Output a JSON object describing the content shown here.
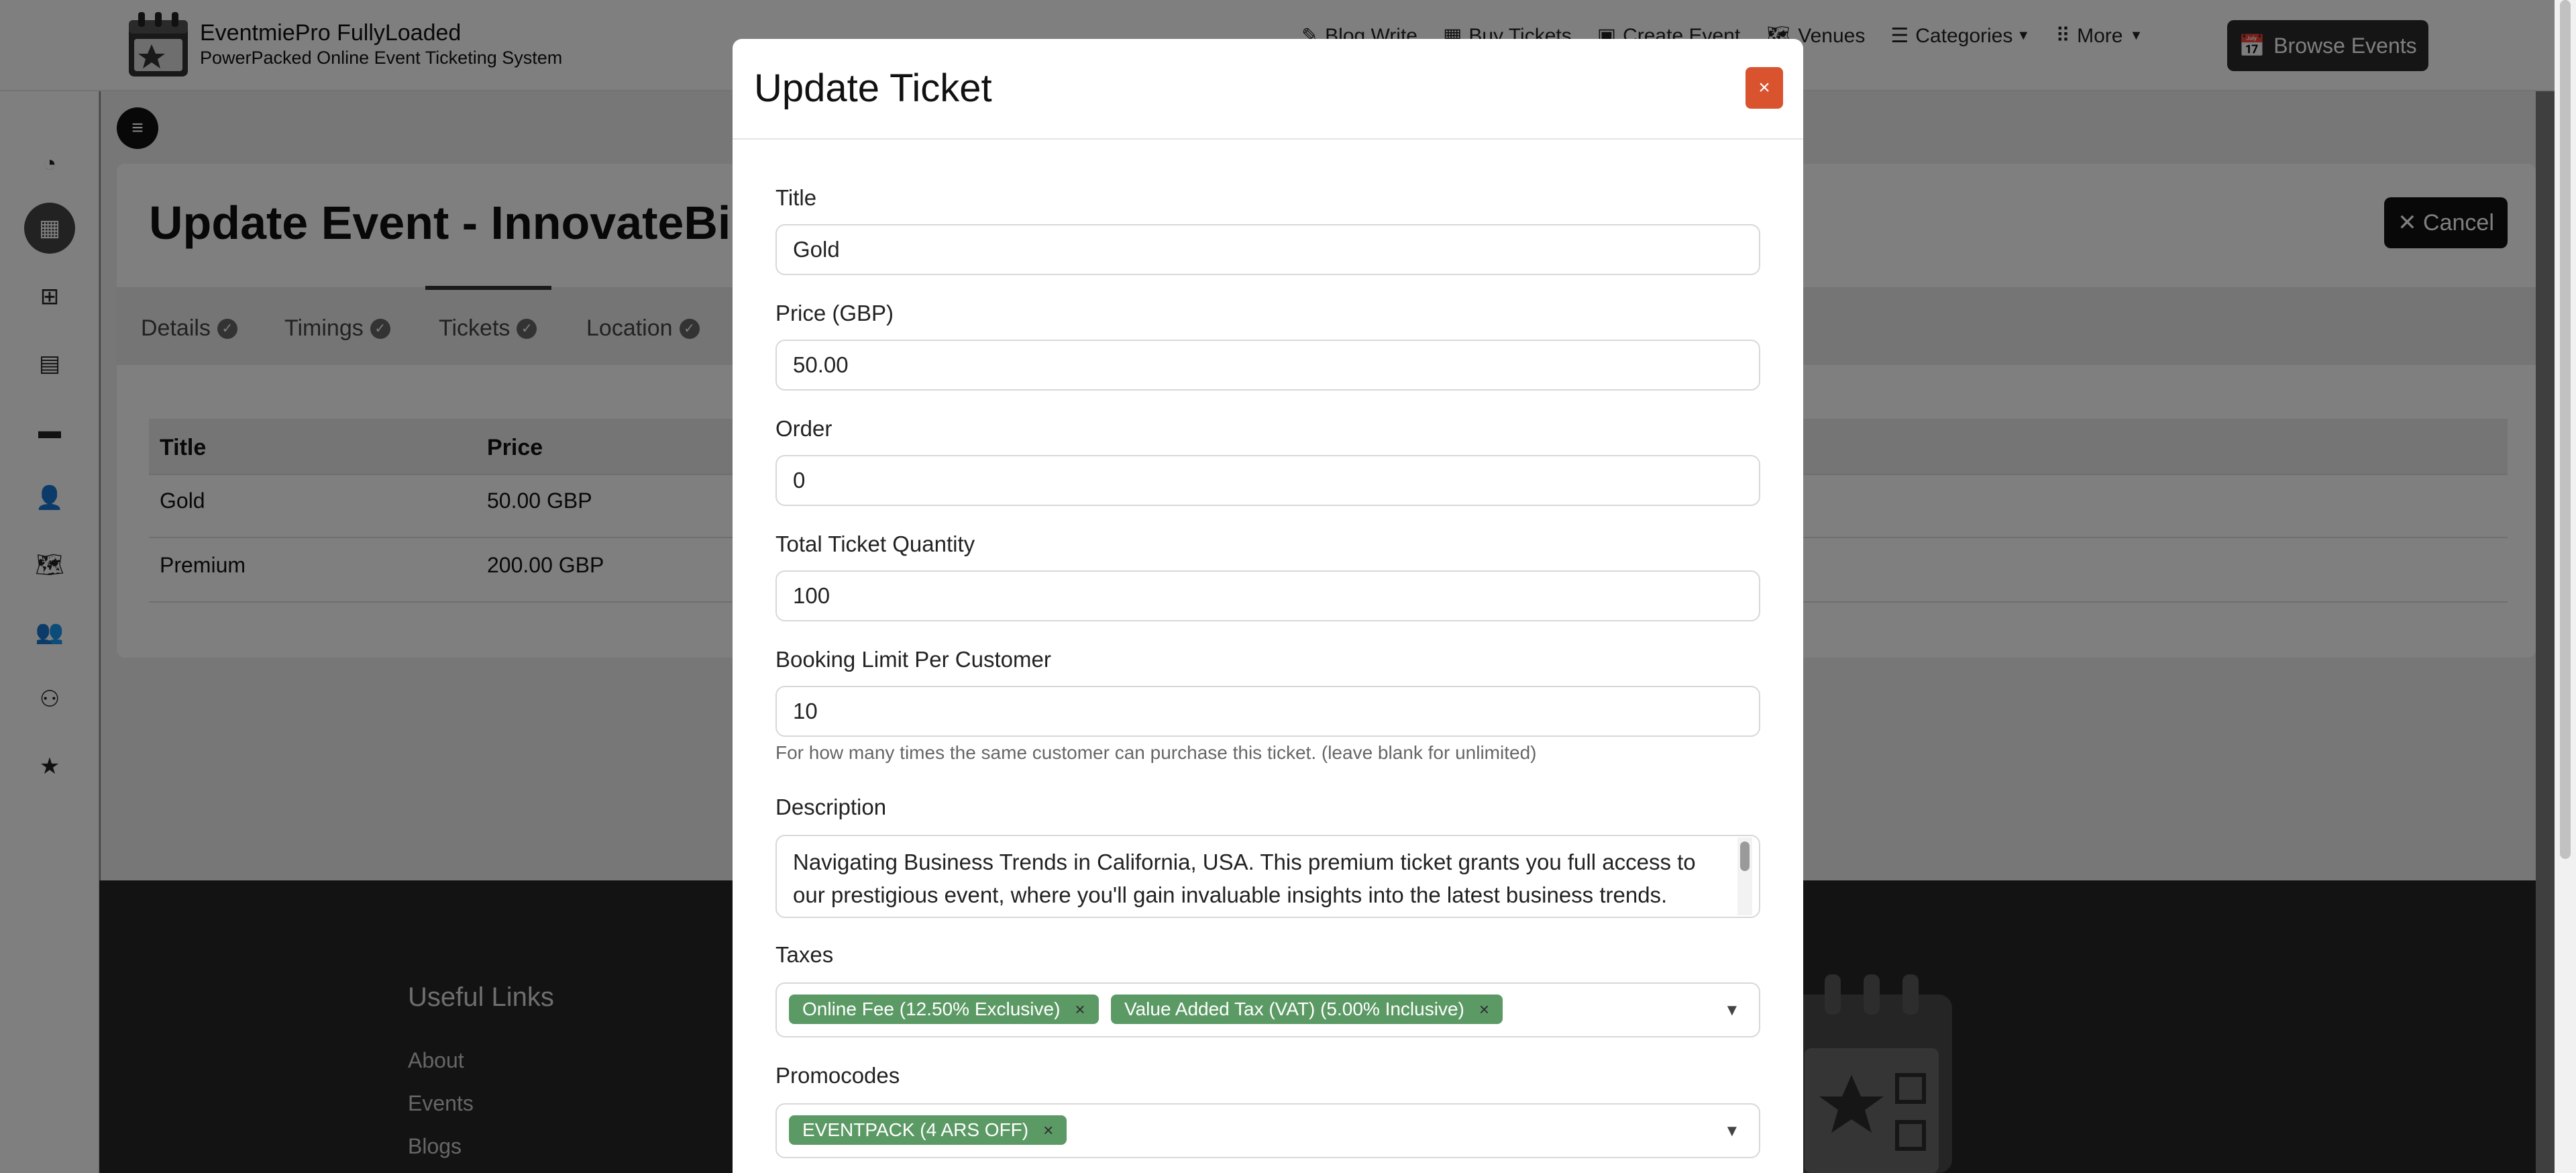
{
  "brand": {
    "title": "EventmiePro FullyLoaded",
    "subtitle": "PowerPacked Online Event Ticketing System"
  },
  "nav": {
    "items": [
      {
        "label": "Blog Write",
        "icon": "blog-icon"
      },
      {
        "label": "Buy Tickets",
        "icon": "ticket-icon"
      },
      {
        "label": "Create Event",
        "icon": "calendar-plus-icon"
      },
      {
        "label": "Venues",
        "icon": "map-icon"
      },
      {
        "label": "Categories",
        "icon": "list-icon"
      },
      {
        "label": "More",
        "icon": "grid-icon"
      }
    ],
    "browse_label": "Browse Events",
    "nav_icons": {
      "venues": "🗺",
      "categories": "☰",
      "more": "⠿",
      "browse": "📅"
    }
  },
  "sidebar": {
    "icons": [
      "dashboard-icon",
      "calendar-icon",
      "grid-icon",
      "id-card-icon",
      "wallet-icon",
      "user-icon",
      "map-icon",
      "users-icon",
      "people-icon",
      "star-icon"
    ],
    "glyphs": [
      "◔",
      "▦",
      "⊞",
      "▤",
      "▬",
      "👤",
      "🗺",
      "👥",
      "⚇",
      "★"
    ]
  },
  "page": {
    "title": "Update Event - InnovateBiz Su",
    "cancel_label": "✕ Cancel",
    "tabs": [
      "Details",
      "Timings",
      "Tickets",
      "Location"
    ],
    "table": {
      "headers": [
        "Title",
        "Price"
      ],
      "rows": [
        {
          "title": "Gold",
          "price": "50.00 GBP"
        },
        {
          "title": "Premium",
          "price": "200.00 GBP"
        }
      ]
    }
  },
  "footer": {
    "heading": "Useful Links",
    "links": [
      "About",
      "Events",
      "Blogs"
    ]
  },
  "modal": {
    "title": "Update Ticket",
    "close_label": "×",
    "fields": {
      "title_label": "Title",
      "title_value": "Gold",
      "price_label": "Price (GBP)",
      "price_value": "50.00",
      "order_label": "Order",
      "order_value": "0",
      "quantity_label": "Total Ticket Quantity",
      "quantity_value": "100",
      "limit_label": "Booking Limit Per Customer",
      "limit_value": "10",
      "limit_help": "For how many times the same customer can purchase this ticket. (leave blank for unlimited)",
      "description_label": "Description",
      "description_value": "Navigating Business Trends in California, USA. This premium ticket grants you full access to our prestigious event, where you'll gain invaluable insights into the latest business trends. Network",
      "taxes_label": "Taxes",
      "taxes": [
        "Online Fee (12.50% Exclusive)",
        "Value Added Tax (VAT) (5.00% Inclusive)"
      ],
      "promocodes_label": "Promocodes",
      "promocodes": [
        "EVENTPACK (4 ARS OFF)"
      ]
    }
  },
  "colors": {
    "accent_green": "#5c9a65",
    "close_red": "#d9532f",
    "dark": "#2a2a2a"
  }
}
